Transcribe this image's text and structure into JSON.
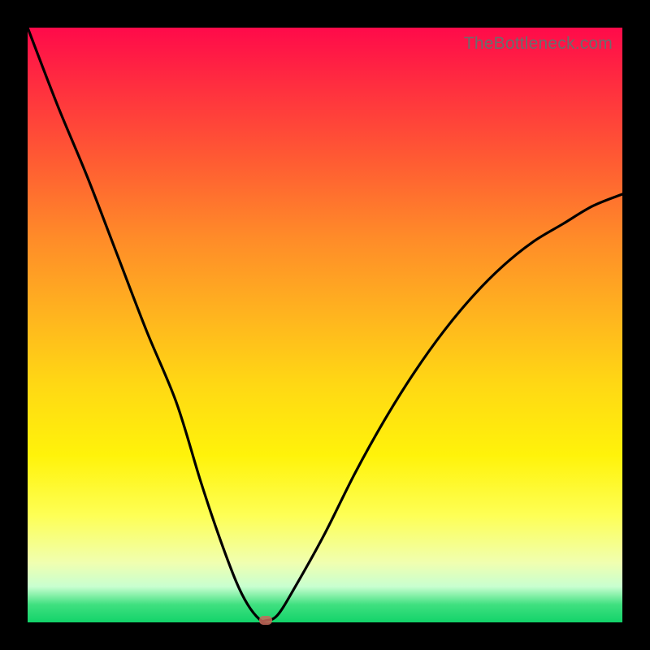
{
  "watermark_text": "TheBottleneck.com",
  "colors": {
    "background": "#000000",
    "curve": "#000000",
    "marker": "#c96a5c"
  },
  "chart_data": {
    "type": "line",
    "title": "",
    "xlabel": "",
    "ylabel": "",
    "xlim": [
      0,
      100
    ],
    "ylim": [
      0,
      100
    ],
    "series": [
      {
        "name": "bottleneck-curve",
        "x": [
          0,
          5,
          10,
          15,
          20,
          25,
          29,
          32,
          35,
          37,
          39,
          40,
          42,
          45,
          50,
          55,
          60,
          65,
          70,
          75,
          80,
          85,
          90,
          95,
          100
        ],
        "y": [
          100,
          87,
          75,
          62,
          49,
          37,
          24,
          15,
          7,
          3,
          0.5,
          0.3,
          1.2,
          6,
          15,
          25,
          34,
          42,
          49,
          55,
          60,
          64,
          67,
          70,
          72
        ]
      }
    ],
    "annotations": [
      {
        "name": "min-marker",
        "x": 40,
        "y": 0.3
      }
    ],
    "gradient_stops": [
      {
        "pos": 0,
        "color": "#ff0a4a"
      },
      {
        "pos": 10,
        "color": "#ff2f3f"
      },
      {
        "pos": 22,
        "color": "#ff5a33"
      },
      {
        "pos": 35,
        "color": "#ff8a29"
      },
      {
        "pos": 48,
        "color": "#ffb31f"
      },
      {
        "pos": 60,
        "color": "#ffd814"
      },
      {
        "pos": 72,
        "color": "#fff30a"
      },
      {
        "pos": 82,
        "color": "#feff55"
      },
      {
        "pos": 90,
        "color": "#f0ffb0"
      },
      {
        "pos": 94,
        "color": "#c8ffd0"
      },
      {
        "pos": 97,
        "color": "#40e080"
      },
      {
        "pos": 100,
        "color": "#12d36a"
      }
    ]
  }
}
